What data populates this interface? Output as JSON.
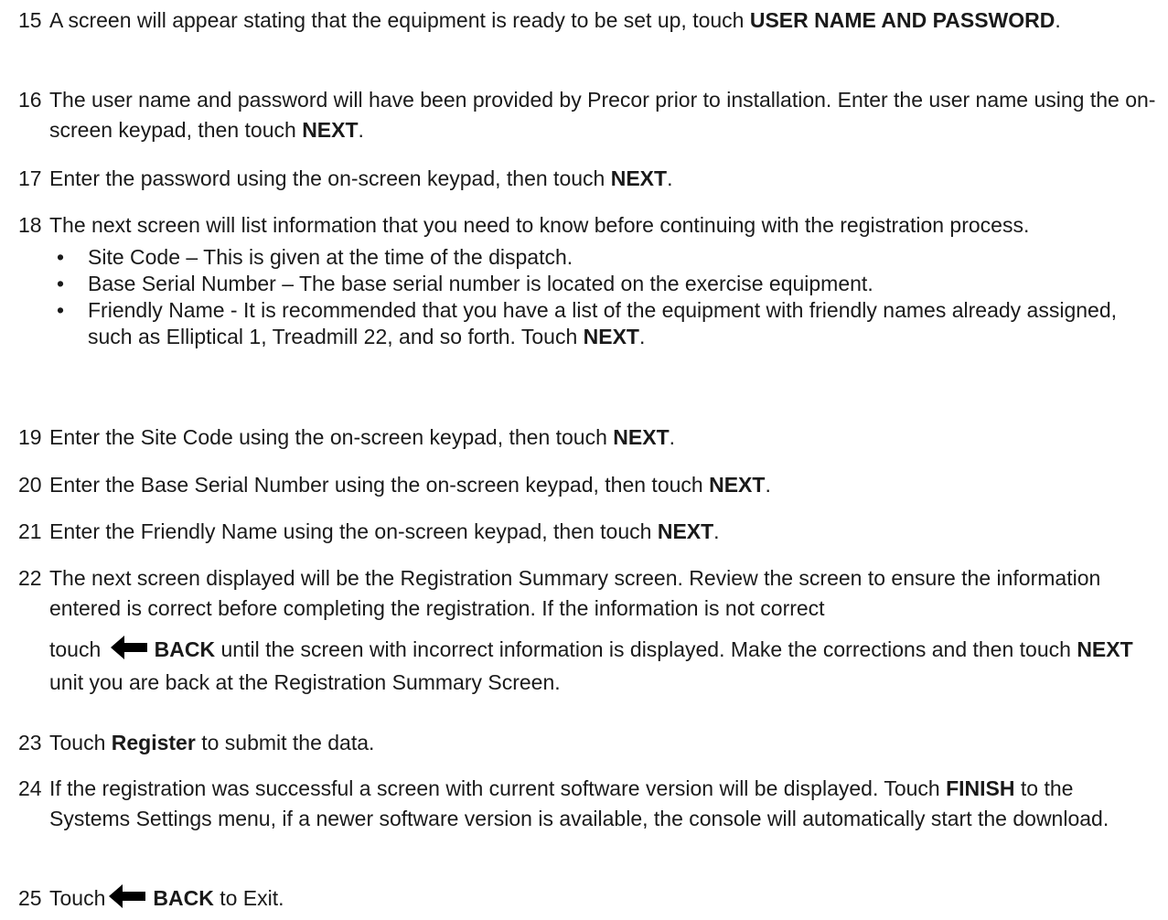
{
  "steps": [
    {
      "num": "15",
      "pre": "A screen will appear stating that the equipment is ready to be set up, touch ",
      "bold": "USER NAME AND PASSWORD",
      "post": "."
    },
    {
      "num": "16",
      "pre": "The user name and password will have been provided by Precor prior to installation. Enter the user name using the on-screen keypad, then touch ",
      "bold": "NEXT",
      "post": "."
    },
    {
      "num": "17",
      "pre": "Enter the password using the on-screen keypad, then touch ",
      "bold": "NEXT",
      "post": "."
    },
    {
      "num": "18",
      "pre": "The next screen will list information that you need to know before continuing with the registration process."
    },
    {
      "num": "19",
      "pre": "Enter the Site Code using the on-screen keypad, then touch ",
      "bold": "NEXT",
      "post": "."
    },
    {
      "num": "20",
      "pre": "Enter the Base Serial Number using the on-screen keypad, then touch ",
      "bold": "NEXT",
      "post": "."
    },
    {
      "num": "21",
      "pre": "Enter the Friendly Name using the on-screen keypad, then touch ",
      "bold": "NEXT",
      "post": "."
    },
    {
      "num": "22",
      "line1": "The next screen displayed will be the Registration Summary screen. Review the screen to ensure the information entered is correct before completing the registration. If the information is not correct",
      "touch": "touch",
      "back": "BACK",
      "mid": " until the screen with incorrect information is displayed. Make the corrections and then touch ",
      "next": "NEXT",
      "post": " unit you are back at the Registration Summary Screen."
    },
    {
      "num": "23",
      "pre": "Touch ",
      "bold": "Register",
      "post": " to submit the data."
    },
    {
      "num": "24",
      "pre": "If the registration was successful a screen with current software version will be displayed. Touch ",
      "bold": "FINISH",
      "post": " to the Systems Settings menu, if a newer software version is available, the console will automatically start the download."
    },
    {
      "num": "25",
      "pre": "Touch",
      "bold": "BACK",
      "post": " to Exit."
    }
  ],
  "bullets": [
    {
      "text": "Site Code – This is given at the time of the dispatch."
    },
    {
      "text": "Base Serial Number – The base serial number is located on the exercise equipment."
    },
    {
      "text": "Friendly Name - It is recommended that you have a list of the equipment with friendly names already assigned, such as Elliptical 1, Treadmill 22, and so forth.  Touch ",
      "bold": "NEXT",
      "post": "."
    }
  ],
  "bullet_glyph": "•",
  "icons": {
    "back": "left-arrow-icon"
  }
}
